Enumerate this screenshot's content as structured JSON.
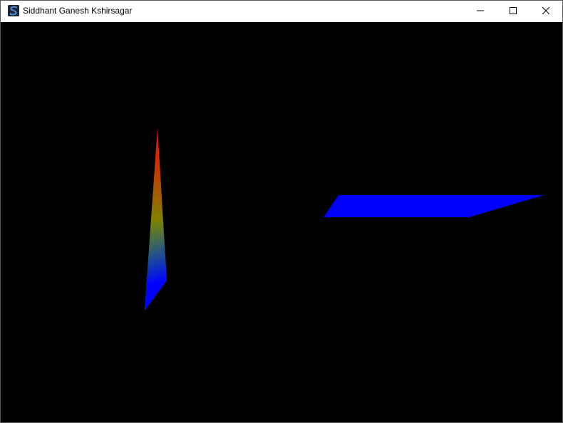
{
  "window": {
    "title": "Siddhant Ganesh Kshirsagar",
    "app_icon": "s-logo-icon",
    "caption_buttons": [
      "minimize-icon",
      "maximize-icon",
      "close-icon"
    ]
  },
  "scene": {
    "background": "#000000",
    "shapes": [
      {
        "kind": "gradient-triangle",
        "vertex_colors": [
          "#ff0000",
          "#00ff00",
          "#0000ff"
        ]
      },
      {
        "kind": "parallelogram",
        "fill": "#0000ff"
      }
    ]
  }
}
